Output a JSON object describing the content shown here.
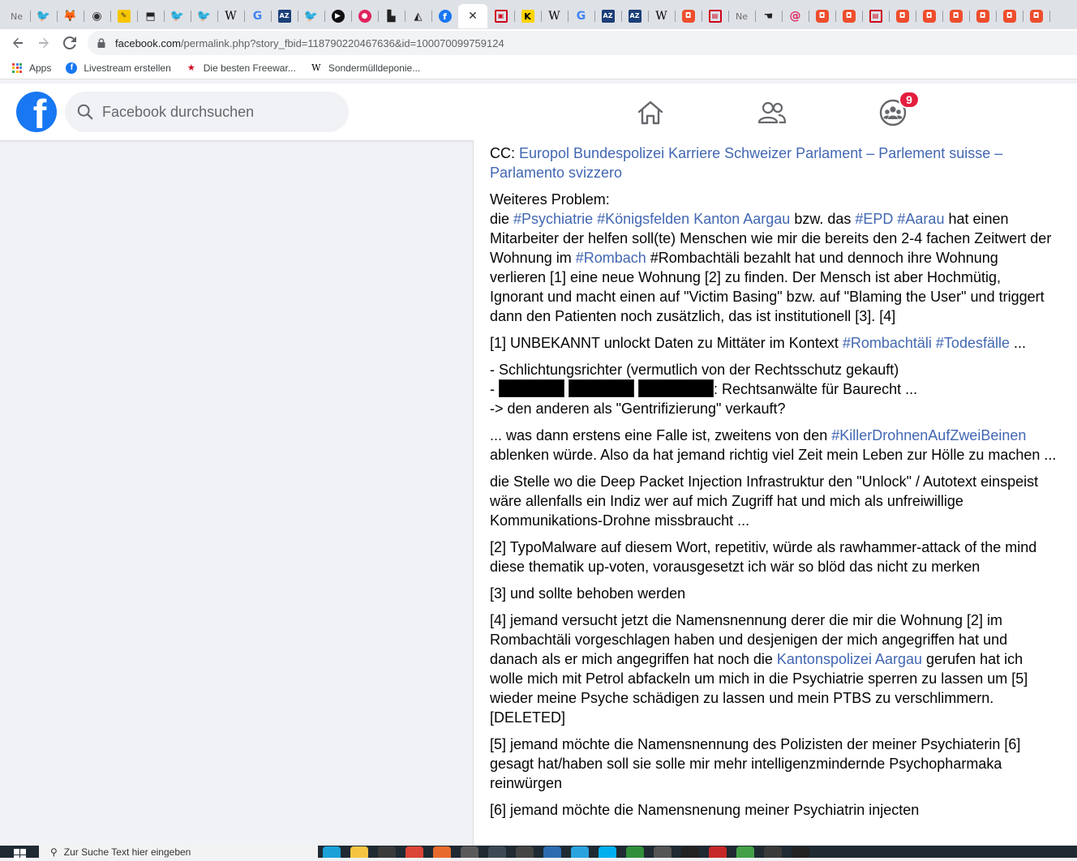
{
  "browser": {
    "tabs": [
      {
        "icon": "new-tab-icon",
        "glyph": "Ne",
        "kind": "ne"
      },
      {
        "icon": "twitter-icon",
        "glyph": "🐦",
        "kind": "tw"
      },
      {
        "icon": "gitlab-icon",
        "glyph": "🦊",
        "kind": "gl"
      },
      {
        "icon": "globe-icon",
        "glyph": "◉",
        "kind": "globe"
      },
      {
        "icon": "yellow-site-icon",
        "glyph": "✎",
        "kind": "ye"
      },
      {
        "icon": "dark-shield-icon",
        "glyph": "⬒",
        "kind": "dark"
      },
      {
        "icon": "twitter-icon",
        "glyph": "🐦",
        "kind": "tw"
      },
      {
        "icon": "twitter-icon",
        "glyph": "🐦",
        "kind": "tw"
      },
      {
        "icon": "wikipedia-icon",
        "glyph": "W",
        "kind": "wiki"
      },
      {
        "icon": "google-icon",
        "glyph": "G",
        "kind": "goo"
      },
      {
        "icon": "az-icon",
        "glyph": "AZ",
        "kind": "az"
      },
      {
        "icon": "twitter-icon",
        "glyph": "🐦",
        "kind": "tw"
      },
      {
        "icon": "play-circle-icon",
        "glyph": "▶",
        "kind": "blk"
      },
      {
        "icon": "red-circle-icon",
        "glyph": "●",
        "kind": "red"
      },
      {
        "icon": "city-icon",
        "glyph": "▙",
        "kind": "dark"
      },
      {
        "icon": "android-icon",
        "glyph": "◭",
        "kind": "dark"
      },
      {
        "icon": "facebook-icon",
        "glyph": "f",
        "kind": "fb"
      },
      {
        "icon": "close-icon",
        "glyph": "✕",
        "kind": "cross",
        "active": true
      },
      {
        "icon": "red-tv-icon",
        "glyph": "▣",
        "kind": "redbox"
      },
      {
        "icon": "k-icon",
        "glyph": "K",
        "kind": "kk"
      },
      {
        "icon": "wikipedia-icon",
        "glyph": "W",
        "kind": "wiki"
      },
      {
        "icon": "google-icon",
        "glyph": "G",
        "kind": "goo"
      },
      {
        "icon": "az-icon",
        "glyph": "AZ",
        "kind": "az"
      },
      {
        "icon": "az-icon",
        "glyph": "AZ",
        "kind": "az"
      },
      {
        "icon": "wikipedia-icon",
        "glyph": "W",
        "kind": "wiki"
      },
      {
        "icon": "orange-bag-icon",
        "glyph": "◘",
        "kind": "orange"
      },
      {
        "icon": "red-cart-icon",
        "glyph": "▤",
        "kind": "redbox"
      },
      {
        "icon": "new-tab-icon",
        "glyph": "Ne",
        "kind": "ne"
      },
      {
        "icon": "hand-icon",
        "glyph": "☚",
        "kind": "dark"
      },
      {
        "icon": "at-icon",
        "glyph": "@",
        "kind": "at"
      },
      {
        "icon": "orange-bag-icon",
        "glyph": "◘",
        "kind": "orange"
      },
      {
        "icon": "orange-bag-icon",
        "glyph": "◘",
        "kind": "orange"
      },
      {
        "icon": "red-cart-icon",
        "glyph": "▤",
        "kind": "redbox"
      },
      {
        "icon": "orange-bag-icon",
        "glyph": "◘",
        "kind": "orange"
      },
      {
        "icon": "orange-bag-icon",
        "glyph": "◘",
        "kind": "orange"
      },
      {
        "icon": "orange-bag-icon",
        "glyph": "◘",
        "kind": "orange"
      },
      {
        "icon": "orange-bag-icon",
        "glyph": "◘",
        "kind": "orange"
      },
      {
        "icon": "orange-bag-icon",
        "glyph": "◘",
        "kind": "orange"
      },
      {
        "icon": "orange-bag-icon",
        "glyph": "◘",
        "kind": "orange"
      }
    ],
    "url": {
      "host": "facebook.com",
      "path": "/permalink.php?story_fbid=118790220467636&id=100070099759124"
    },
    "bookmarks": {
      "apps": "Apps",
      "livestream": "Livestream erstellen",
      "freeware": "Die besten Freewar...",
      "sondermuell": "Sondermülldeponie..."
    }
  },
  "facebook": {
    "search_placeholder": "Facebook durchsuchen",
    "groups_badge": "9",
    "logo_letter": "f"
  },
  "post": {
    "cc_prefix": "CC: ",
    "cc_links": "Europol Bundespolizei Karriere Schweizer Parlament – Parlement suisse – Parlamento svizzero",
    "p2_line1": "Weiteres Problem:",
    "p2_a": "die ",
    "p2_tag1": "#Psychiatrie",
    "p2_tag2": "#Königsfelden",
    "p2_tag3": "Kanton Aargau",
    "p2_b": " bzw. das ",
    "p2_tag4": "#EPD",
    "p2_tag5": "#Aarau",
    "p2_c": " hat einen Mitarbeiter der helfen soll(te) Menschen wie mir die bereits den 2-4 fachen Zeitwert der Wohnung im ",
    "p2_tag6": "#Rombach",
    "p2_d": " #Rombachtäli bezahlt hat und dennoch ihre Wohnung verlieren [1] eine neue Wohnung [2] zu finden. Der Mensch ist aber Hochmütig, Ignorant und macht einen auf \"Victim Basing\" bzw. auf \"Blaming the User\" und triggert dann den Patienten noch zusätzlich, das ist institutionell [3]. [4]",
    "p3_a": "[1] UNBEKANNT unlockt Daten zu Mittäter im Kontext ",
    "p3_tag1": "#Rombachtäli",
    "p3_tag2": "#Todesfälle",
    "p3_b": " ...",
    "p4_line1": "- Schlichtungsrichter (vermutlich von der Rechtsschutz gekauft)",
    "p4_line2_prefix": "- ",
    "p4_line2_suffix": ": Rechtsanwälte für Baurecht ...",
    "p4_line3": "-> den anderen als \"Gentrifizierung\" verkauft?",
    "p5_a": "... was dann erstens eine Falle ist, zweitens von den ",
    "p5_tag": "#KillerDrohnenAufZweiBeinen",
    "p5_b": " ablenken würde. Also da hat jemand richtig viel Zeit mein Leben zur Hölle zu machen ...",
    "p6": "die Stelle wo die Deep Packet Injection Infrastruktur den \"Unlock\" / Autotext einspeist wäre allenfalls ein Indiz wer auf mich Zugriff hat und mich als unfreiwillige Kommunikations-Drohne missbraucht ...",
    "p7": "[2] TypoMalware auf diesem Wort, repetitiv, würde als rawhammer-attack of the mind diese thematik up-voten, vorausgesetzt ich wär so blöd das nicht zu merken",
    "p8": "[3] und sollte behoben werden",
    "p9_a": "[4] jemand versucht jetzt die Namensnennung derer die mir die Wohnung [2] im Rombachtäli vorgeschlagen haben und desjenigen der mich angegriffen hat und danach als er mich angegriffen hat noch die ",
    "p9_link": "Kantonspolizei Aargau",
    "p9_b": " gerufen hat ich wolle mich mit Petrol abfackeln um mich in die Psychiatrie sperren zu lassen um [5] wieder meine Psyche schädigen zu lassen und mein PTBS zu verschlimmern. [DELETED]",
    "p10": "[5] jemand möchte die Namensnennung des Polizisten der meiner Psychiaterin [6] gesagt hat/haben soll sie solle mir mehr intelligenzmindernde Psychopharmaka reinwürgen",
    "p11": "[6] jemand möchte die Namensnenung meiner Psychiatrin injecten"
  },
  "taskbar": {
    "search_text": "Zur Suche Text hier eingeben"
  },
  "colors": {
    "fb_blue": "#1877f2",
    "link": "#4267b2",
    "badge_red": "#e41e3f"
  }
}
